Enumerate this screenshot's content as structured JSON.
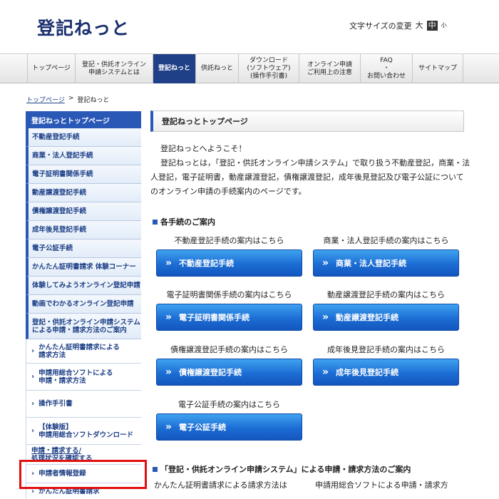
{
  "header": {
    "logo": "登記ねっと",
    "fontsize_label": "文字サイズの変更",
    "fontsize_large": "大",
    "fontsize_medium": "中",
    "fontsize_small": "小"
  },
  "gnav": [
    {
      "label": "トップページ"
    },
    {
      "label": "登記・供託オンライン\n申請システムとは"
    },
    {
      "label": "登記ねっと"
    },
    {
      "label": "供託ねっと"
    },
    {
      "label": "ダウンロード\n(ソフトウェア)\n(操作手引書)"
    },
    {
      "label": "オンライン申請\nご利用上の注意"
    },
    {
      "label": "FAQ\n・\nお問い合わせ"
    },
    {
      "label": "サイトマップ"
    }
  ],
  "breadcrumb": {
    "home": "トップページ",
    "sep": ">",
    "current": "登記ねっと"
  },
  "sidebar": {
    "head": "登記ねっとトップページ",
    "items": [
      {
        "label": "不動産登記手続"
      },
      {
        "label": "商業・法人登記手続"
      },
      {
        "label": "電子証明書関係手続"
      },
      {
        "label": "動産譲渡登記手続"
      },
      {
        "label": "債権譲渡登記手続"
      },
      {
        "label": "成年後見登記手続"
      },
      {
        "label": "電子公証手続"
      },
      {
        "label": "かんたん証明書請求 体験コーナー"
      },
      {
        "label": "体験してみようオンライン登記申請"
      },
      {
        "label": "動画でわかるオンライン登記申請"
      },
      {
        "label": "登記・供託オンライン申請システム\nによる申請・請求方法のご案内"
      }
    ],
    "subs": [
      {
        "label": "かんたん証明書請求による\n請求方法"
      },
      {
        "label": "申請用総合ソフトによる\n申請・請求方法"
      },
      {
        "label": "操作手引書"
      },
      {
        "label": "【体験版】\n申請用総合ソフトダウンロード"
      }
    ],
    "plain": "申請・請求する/\n処理状況を確認する",
    "subs2": [
      {
        "label": "申請者情報登録"
      },
      {
        "label": "かんたん証明書請求"
      }
    ]
  },
  "main": {
    "title": "登記ねっとトップページ",
    "welcome": "登記ねっとへようこそ！",
    "intro": "登記ねっとは，「登記・供託オンライン申請システム」で取り扱う不動産登記，商業・法人登記，電子証明書，動産譲渡登記，債権譲渡登記，成年後見登記及び電子公証についてのオンライン申請の手続案内のページです。",
    "section1": "各手続のご案内",
    "procedures": [
      {
        "caption": "不動産登記手続の案内はこちら",
        "button": "不動産登記手続"
      },
      {
        "caption": "商業・法人登記手続の案内はこちら",
        "button": "商業・法人登記手続"
      },
      {
        "caption": "電子証明書関係手続の案内はこちら",
        "button": "電子証明書関係手続"
      },
      {
        "caption": "動産譲渡登記手続の案内はこちら",
        "button": "動産譲渡登記手続"
      },
      {
        "caption": "債権譲渡登記手続の案内はこちら",
        "button": "債権譲渡登記手続"
      },
      {
        "caption": "成年後見登記手続の案内はこちら",
        "button": "成年後見登記手続"
      },
      {
        "caption": "電子公証手続の案内はこちら",
        "button": "電子公証手続"
      }
    ],
    "section2": "「登記・供託オンライン申請システム」による申請・請求方法のご案内",
    "bottom_left": "かんたん証明書請求による請求方法は",
    "bottom_right": "申請用総合ソフトによる申請・請求方"
  }
}
